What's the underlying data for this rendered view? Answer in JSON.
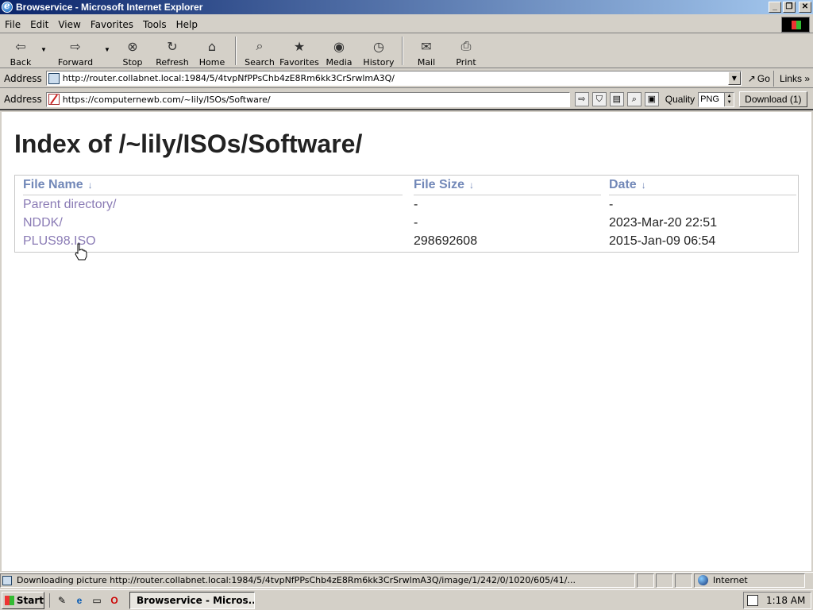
{
  "window": {
    "title": "Browservice - Microsoft Internet Explorer"
  },
  "menu": [
    "File",
    "Edit",
    "View",
    "Favorites",
    "Tools",
    "Help"
  ],
  "toolbar": {
    "back": "Back",
    "forward": "Forward",
    "stop": "Stop",
    "refresh": "Refresh",
    "home": "Home",
    "search": "Search",
    "favorites": "Favorites",
    "media": "Media",
    "history": "History",
    "mail": "Mail",
    "print": "Print"
  },
  "address1": {
    "label": "Address",
    "url": "http://router.collabnet.local:1984/5/4tvpNfPPsChb4zE8Rm6kk3CrSrwlmA3Q/",
    "go": "Go",
    "links": "Links"
  },
  "address2": {
    "label": "Address",
    "url": "https://computernewb.com/~lily/ISOs/Software/",
    "quality_label": "Quality",
    "quality_value": "PNG",
    "download": "Download (1)"
  },
  "page": {
    "heading": "Index of /~lily/ISOs/Software/",
    "columns": {
      "name": "File Name",
      "size": "File Size",
      "date": "Date",
      "sort_arrow": "↓"
    },
    "rows": [
      {
        "name": "Parent directory/",
        "size": "-",
        "date": "-"
      },
      {
        "name": "NDDK/",
        "size": "-",
        "date": "2023-Mar-20 22:51"
      },
      {
        "name": "PLUS98.ISO",
        "size": "298692608",
        "date": "2015-Jan-09 06:54"
      }
    ]
  },
  "status": {
    "text": "Downloading picture http://router.collabnet.local:1984/5/4tvpNfPPsChb4zE8Rm6kk3CrSrwlmA3Q/image/1/242/0/1020/605/41/...",
    "zone": "Internet"
  },
  "taskbar": {
    "start": "Start",
    "task": "Browservice - Micros...",
    "clock": "1:18 AM"
  }
}
